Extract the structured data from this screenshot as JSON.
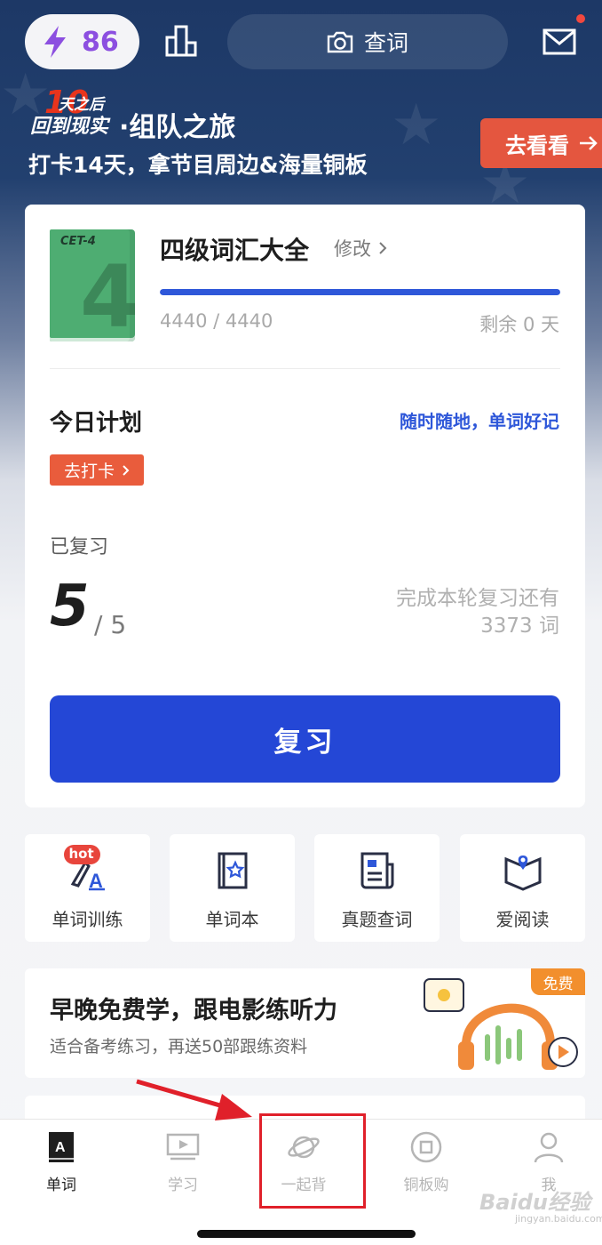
{
  "header": {
    "energy_value": "86",
    "search_label": "查词"
  },
  "banner": {
    "logo_top": "天之后",
    "logo_bottom": "回到现实",
    "logo_mark": "10",
    "title": "·组队之旅",
    "subtitle": "打卡14天，拿节目周边&海量铜板",
    "button_label": "去看看"
  },
  "book": {
    "cover_tag": "CET-4",
    "cover_number": "4",
    "title": "四级词汇大全",
    "edit_label": "修改",
    "progress_text": "4440 / 4440",
    "progress_fraction": 1.0,
    "remaining_text": "剩余 0 天"
  },
  "plan": {
    "title": "今日计划",
    "slogan": "随时随地，单词好记",
    "checkin_label": "去打卡",
    "reviewed_label": "已复习",
    "reviewed_count": "5",
    "reviewed_total": "/ 5",
    "remain_line1": "完成本轮复习还有",
    "remain_line2": "3373 词",
    "review_button": "复习"
  },
  "tiles": [
    {
      "label": "单词训练",
      "icon": "word-training-icon",
      "badge": "hot"
    },
    {
      "label": "单词本",
      "icon": "wordbook-icon"
    },
    {
      "label": "真题查词",
      "icon": "exam-lookup-icon"
    },
    {
      "label": "爱阅读",
      "icon": "reading-icon"
    }
  ],
  "promo": {
    "title": "早晚免费学，跟电影练听力",
    "subtitle": "适合备考练习，再送50部跟练资料",
    "badge": "免费"
  },
  "tabbar": [
    {
      "label": "单词",
      "icon": "word-tab-icon",
      "active": true
    },
    {
      "label": "学习",
      "icon": "study-tab-icon",
      "active": false
    },
    {
      "label": "一起背",
      "icon": "planet-tab-icon",
      "active": false
    },
    {
      "label": "铜板购",
      "icon": "coin-shop-tab-icon",
      "active": false
    },
    {
      "label": "我",
      "icon": "profile-tab-icon",
      "active": false
    }
  ],
  "watermark": {
    "text": "Baidu经验",
    "sub": "jingyan.baidu.com"
  },
  "colors": {
    "accent_blue": "#2447d6",
    "header_navy": "#1d3866",
    "checkin_orange": "#e95c3c",
    "energy_purple": "#8c4fe0",
    "annotation_red": "#e0202a"
  }
}
